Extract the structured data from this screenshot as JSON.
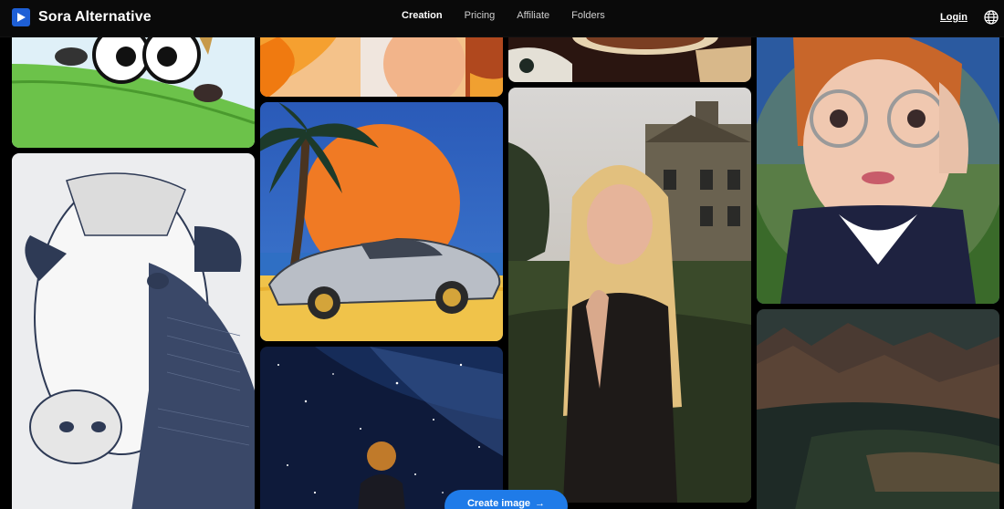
{
  "app": {
    "name": "Sora Alternative"
  },
  "nav": {
    "items": [
      {
        "label": "Creation",
        "active": true
      },
      {
        "label": "Pricing",
        "active": false
      },
      {
        "label": "Affiliate",
        "active": false
      },
      {
        "label": "Folders",
        "active": false
      }
    ],
    "login_label": "Login",
    "language_icon": "globe-icon"
  },
  "gallery": {
    "images": [
      {
        "name": "cartoon-cat-grass",
        "subject": "cartoon cat on grass hill"
      },
      {
        "name": "engraved-cow",
        "subject": "engraved cow portrait"
      },
      {
        "name": "orange-still-life",
        "subject": "orange flower still life"
      },
      {
        "name": "retro-sunset-car",
        "subject": "silver sports car under palm tree and sunset"
      },
      {
        "name": "starry-night-child",
        "subject": "child under starry night sky"
      },
      {
        "name": "table-food",
        "subject": "plates on a table"
      },
      {
        "name": "blonde-woman-manor",
        "subject": "blonde woman in front of manor house"
      },
      {
        "name": "fisheye-girl-glasses",
        "subject": "girl with glasses fisheye portrait"
      },
      {
        "name": "mountain-landscape",
        "subject": "mountain valley landscape"
      }
    ]
  },
  "cta": {
    "label": "Create image",
    "arrow": "→"
  },
  "colors": {
    "accent": "#1f7be8",
    "header_bg": "#0a0a0a",
    "logo": "#1e5fd6"
  }
}
